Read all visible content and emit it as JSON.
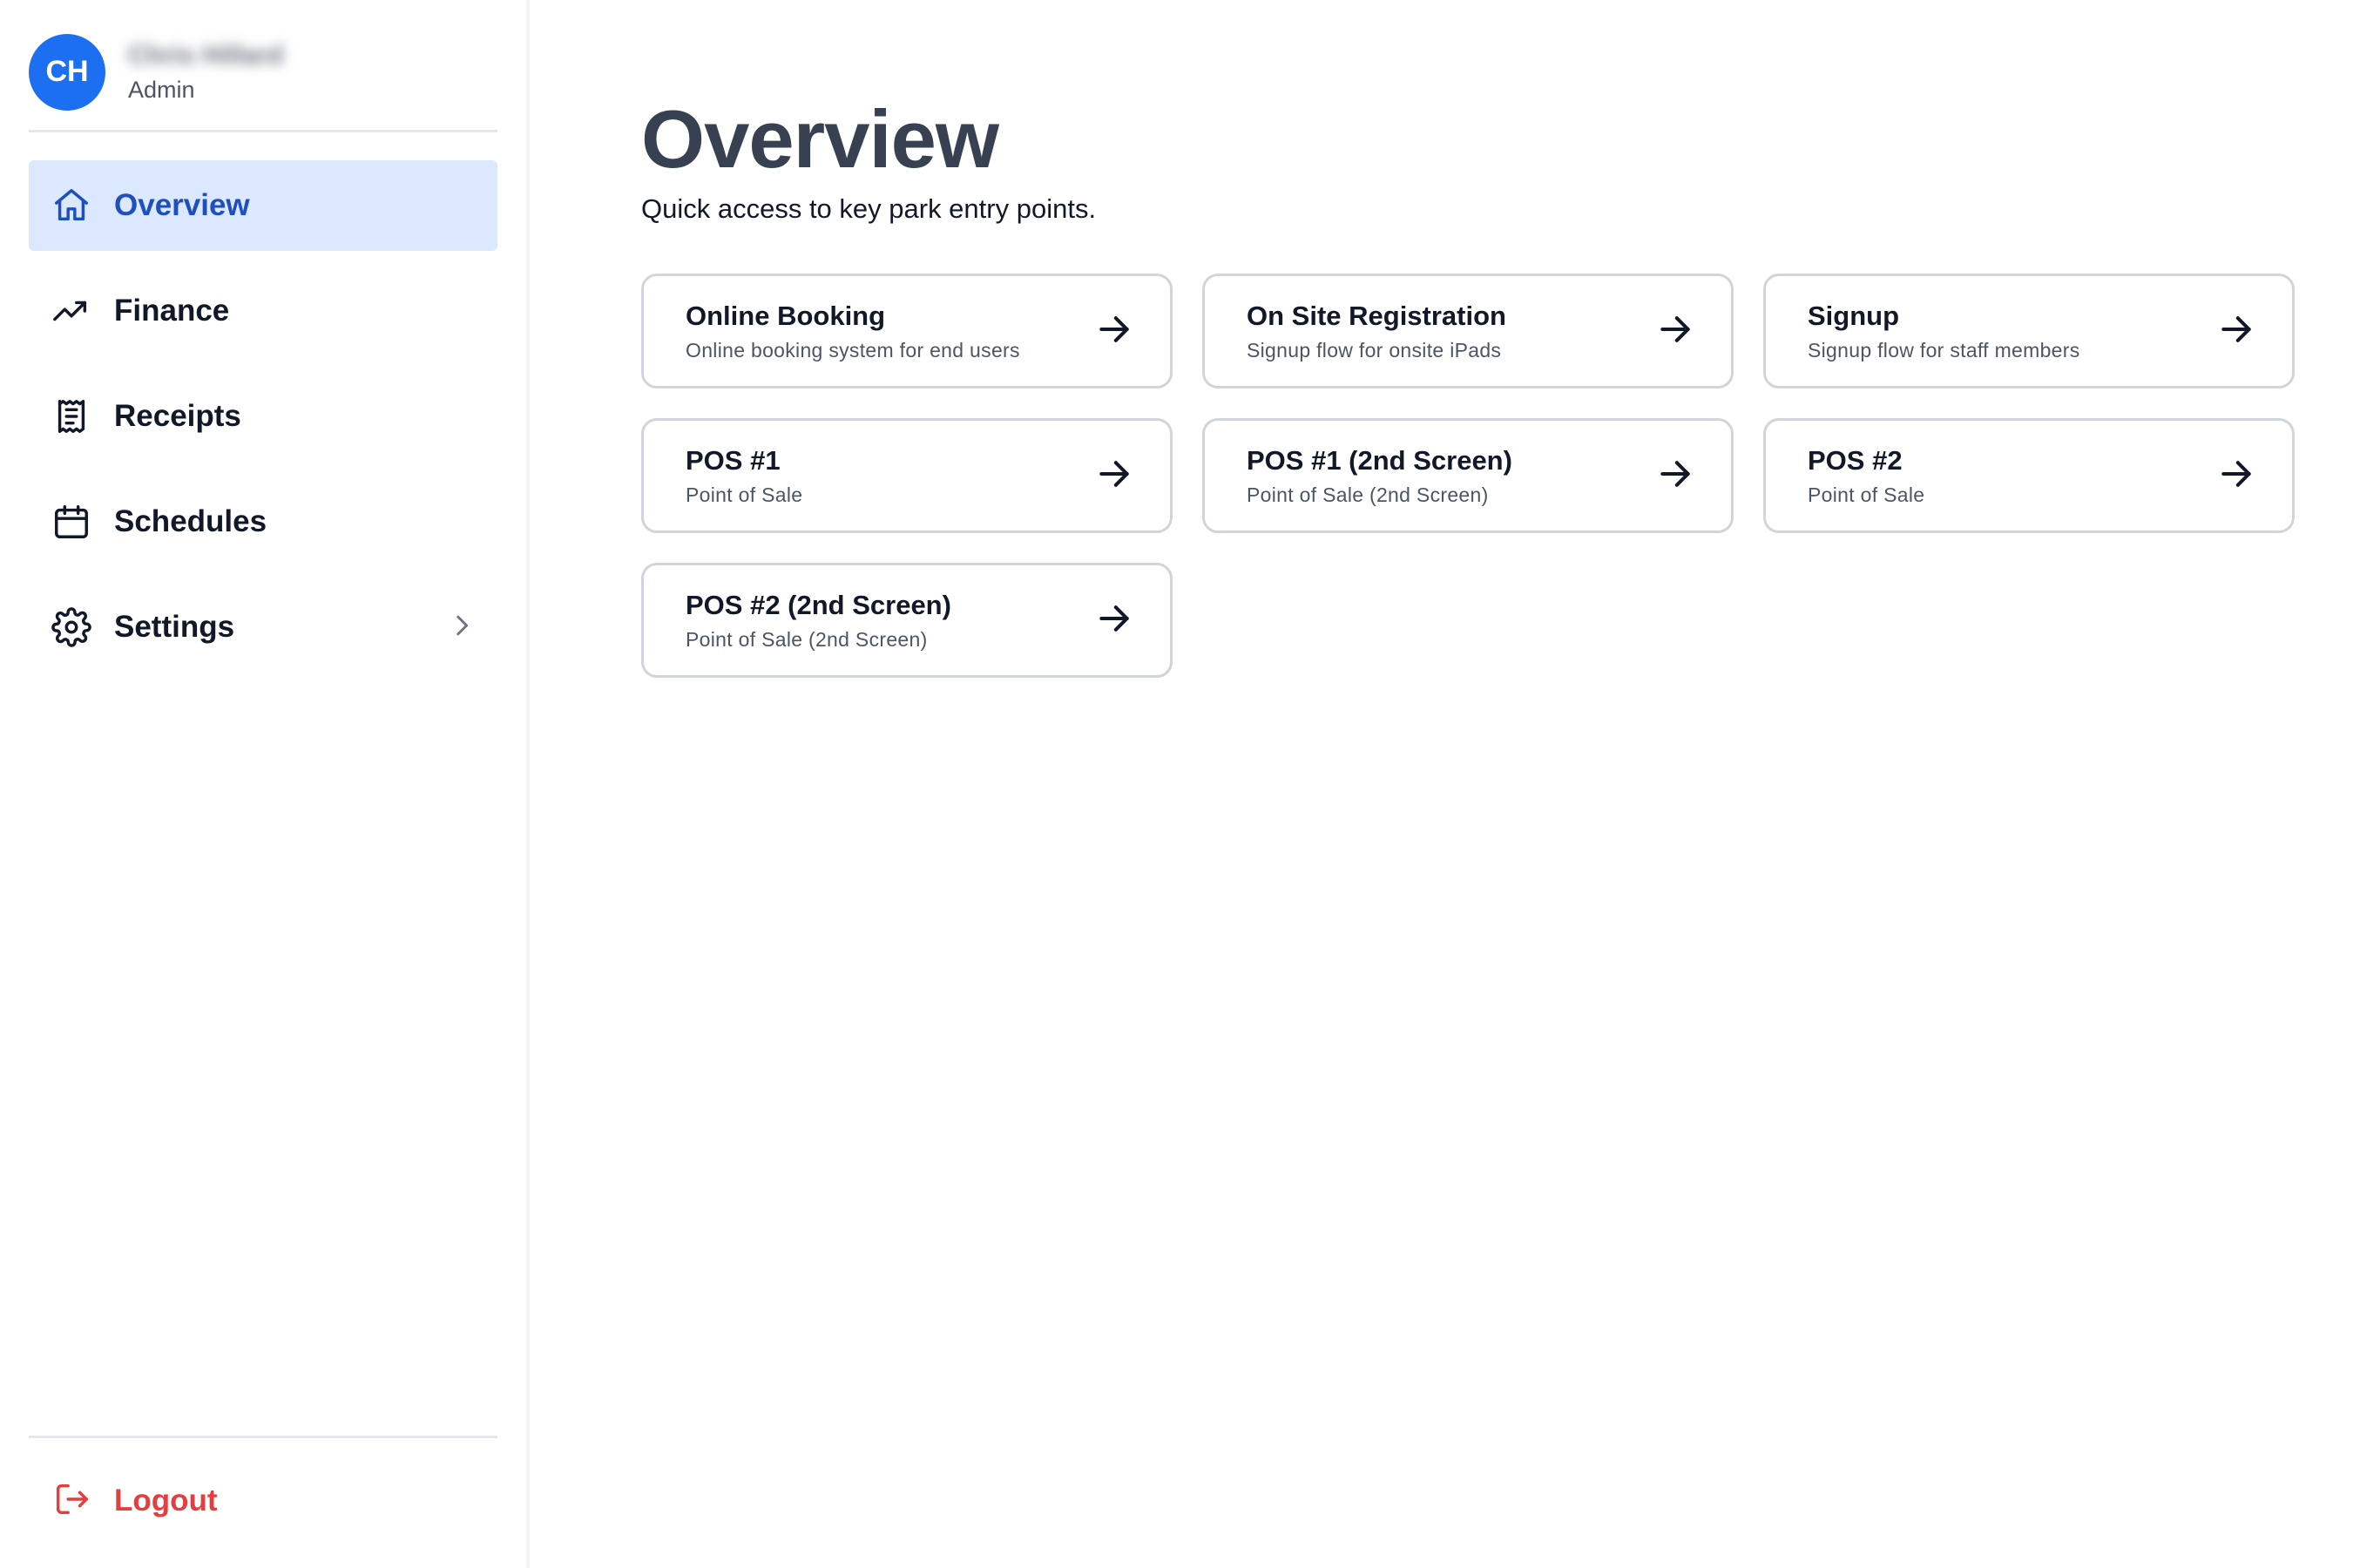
{
  "user": {
    "initials": "CH",
    "name": "Chris Hillard",
    "role": "Admin"
  },
  "sidebar": {
    "items": [
      {
        "label": "Overview",
        "icon": "home-icon",
        "active": true
      },
      {
        "label": "Finance",
        "icon": "trending-up-icon"
      },
      {
        "label": "Receipts",
        "icon": "receipt-icon"
      },
      {
        "label": "Schedules",
        "icon": "calendar-icon"
      },
      {
        "label": "Settings",
        "icon": "gear-icon",
        "has_submenu": true
      }
    ],
    "logout_label": "Logout"
  },
  "main": {
    "title": "Overview",
    "subtitle": "Quick access to key park entry points.",
    "cards": [
      {
        "title": "Online Booking",
        "description": "Online booking system for end users"
      },
      {
        "title": "On Site Registration",
        "description": "Signup flow for onsite iPads"
      },
      {
        "title": "Signup",
        "description": "Signup flow for staff members"
      },
      {
        "title": "POS #1",
        "description": "Point of Sale"
      },
      {
        "title": "POS #1 (2nd Screen)",
        "description": "Point of Sale (2nd Screen)"
      },
      {
        "title": "POS #2",
        "description": "Point of Sale"
      },
      {
        "title": "POS #2 (2nd Screen)",
        "description": "Point of Sale (2nd Screen)"
      }
    ]
  },
  "colors": {
    "accent": "#1d6ff2",
    "active_bg": "#dbe8fd",
    "active_text": "#1e4fbf",
    "danger": "#e53e3e"
  }
}
